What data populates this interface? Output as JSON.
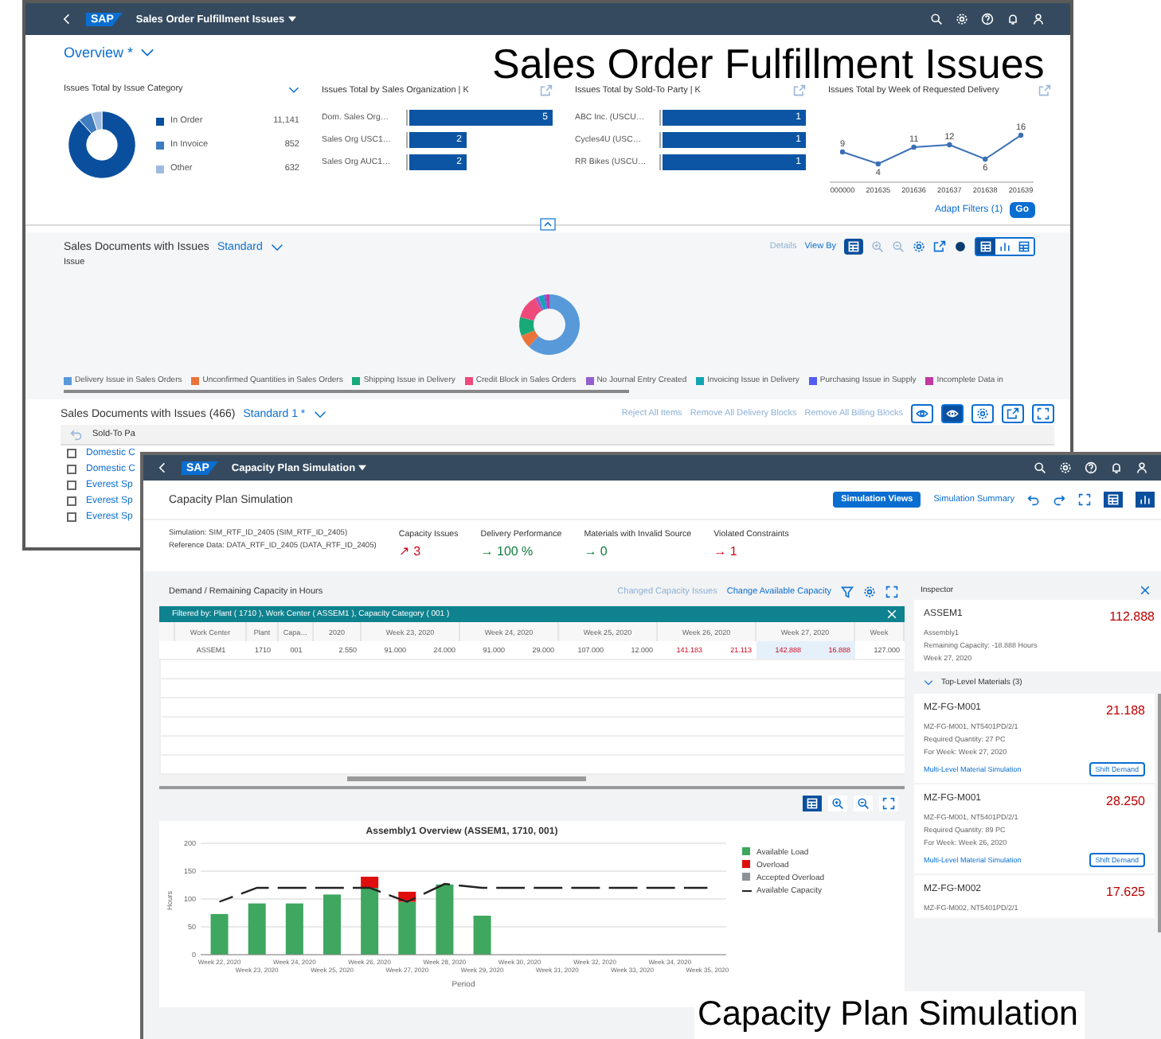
{
  "sales_window": {
    "shell": {
      "logo": "SAP",
      "title": "Sales Order Fulfillment Issues"
    },
    "variant": "Overview *",
    "cards": [
      {
        "title": "Issues Total by Issue Category",
        "kind": "donut",
        "legend": [
          {
            "label": "In Order",
            "value": "11,141",
            "color": "#0a4f9e"
          },
          {
            "label": "In Invoice",
            "value": "852",
            "color": "#3f7cc0"
          },
          {
            "label": "Other",
            "value": "632",
            "color": "#9dbbe0"
          }
        ]
      },
      {
        "title": "Issues Total by Sales Organization | K",
        "chart_data": {
          "type": "bar",
          "orientation": "horizontal",
          "categories": [
            "Dom. Sales Org…",
            "Sales Org USC1…",
            "Sales Org AUC1…"
          ],
          "values": [
            5,
            2,
            2
          ],
          "data_labels": true
        }
      },
      {
        "title": "Issues Total by Sold-To Party | K",
        "chart_data": {
          "type": "bar",
          "orientation": "horizontal",
          "categories": [
            "ABC Inc. (USCU…",
            "Cycles4U (USC…",
            "RR Bikes (USCU…"
          ],
          "values": [
            1,
            1,
            1
          ],
          "data_labels": true
        }
      },
      {
        "title": "Issues Total by Week of Requested Delivery",
        "chart_data": {
          "type": "line",
          "categories": [
            "000000",
            "201635",
            "201636",
            "201637",
            "201638",
            "201639"
          ],
          "values": [
            9,
            4,
            11,
            12,
            6,
            16
          ],
          "data_labels": true,
          "marker": true
        }
      }
    ],
    "adapt_filters": "Adapt Filters (1)",
    "go": "Go",
    "section": {
      "title": "Sales Documents with Issues",
      "variant": "Standard",
      "details": "Details",
      "view_by": "View By",
      "view_switch": [
        {
          "selected": true
        },
        {
          "selected": false
        },
        {
          "selected": false
        }
      ],
      "chart_label": "Issue",
      "legend": [
        {
          "label": "Delivery Issue in Sales Orders",
          "color": "#5899da"
        },
        {
          "label": "Unconfirmed Quantities in Sales Orders",
          "color": "#e8743b"
        },
        {
          "label": "Shipping Issue in Delivery",
          "color": "#19a979"
        },
        {
          "label": "Credit Block in Sales Orders",
          "color": "#ed4a7b"
        },
        {
          "label": "No Journal Entry Created",
          "color": "#945ecf"
        },
        {
          "label": "Invoicing Issue in Delivery",
          "color": "#13a4b4"
        },
        {
          "label": "Purchasing Issue in Supply",
          "color": "#525df4"
        },
        {
          "label": "Incomplete Data in",
          "color": "#bf399e"
        }
      ]
    },
    "table": {
      "title": "Sales Documents with Issues (466)",
      "variant": "Standard 1 *",
      "actions": [
        "Reject All Items",
        "Remove All Delivery Blocks",
        "Remove All Billing Blocks"
      ],
      "column": "Sold-To Pa",
      "rows": [
        {
          "text": "Domestic C",
          "selected": false
        },
        {
          "text": "Domestic C",
          "selected": false
        },
        {
          "text": "Everest Sp",
          "selected": false
        },
        {
          "text": "Everest Sp",
          "selected": false
        },
        {
          "text": "Everest Sp",
          "selected": false
        }
      ]
    }
  },
  "capacity_window": {
    "shell": {
      "logo": "SAP",
      "title": "Capacity Plan Simulation"
    },
    "header": {
      "title": "Capacity Plan Simulation",
      "views_button": "Simulation Views",
      "summary_link": "Simulation Summary",
      "view_toggles": [
        {
          "selected": true
        },
        {
          "selected": true
        }
      ]
    },
    "info": [
      "Simulation: SIM_RTF_ID_2405 (SIM_RTF_ID_2405)",
      "Reference Data: DATA_RTF_ID_2405 (DATA_RTF_ID_2405)"
    ],
    "kpis": [
      {
        "label": "Capacity Issues",
        "arrow": "↗",
        "value": "3",
        "color": "#d0021b"
      },
      {
        "label": "Delivery Performance",
        "arrow": "→",
        "value": "100 %",
        "color": "#107e3e"
      },
      {
        "label": "Materials with Invalid Source",
        "arrow": "→",
        "value": "0",
        "color": "#107e3e"
      },
      {
        "label": "Violated Constraints",
        "arrow": "→",
        "value": "1",
        "color": "#d0021b"
      }
    ],
    "demand": {
      "title": "Demand / Remaining Capacity in Hours",
      "links": [
        {
          "text": "Changed Capacity Issues",
          "disabled": true
        },
        {
          "text": "Change Available Capacity",
          "disabled": false
        }
      ],
      "filter": "Filtered by: Plant ( 1710 ), Work Center ( ASSEM1 ), Capacity Category ( 001 )",
      "columns": [
        "Work Center",
        "Plant",
        "Capa…"
      ],
      "weeks": [
        {
          "label": "2020",
          "partial": true,
          "selected": false
        },
        {
          "label": "Week 23, 2020",
          "partial": false,
          "selected": false
        },
        {
          "label": "Week 24, 2020",
          "partial": false,
          "selected": false
        },
        {
          "label": "Week 25, 2020",
          "partial": false,
          "selected": false
        },
        {
          "label": "Week 26, 2020",
          "partial": false,
          "selected": false
        },
        {
          "label": "Week 27, 2020",
          "partial": false,
          "selected": true
        },
        {
          "label": "Week",
          "partial": true,
          "selected": false
        }
      ],
      "row": {
        "work_center": "ASSEM1",
        "plant": "1710",
        "category": "001",
        "cells": [
          {
            "text": "2.550",
            "over": false
          },
          {
            "text": "91.000",
            "over": false
          },
          {
            "text": "24.000",
            "over": false
          },
          {
            "text": "91.000",
            "over": false
          },
          {
            "text": "29.000",
            "over": false
          },
          {
            "text": "107.000",
            "over": false
          },
          {
            "text": "12.000",
            "over": false
          },
          {
            "text": "141.183",
            "over": true
          },
          {
            "text": "21.113",
            "over": true
          },
          {
            "text": "142.888",
            "over": true
          },
          {
            "text": "16.888",
            "over": true
          },
          {
            "text": "127.000",
            "over": false
          }
        ]
      },
      "chart_tools": [
        {
          "selected": true
        },
        {
          "selected": false
        },
        {
          "selected": false
        },
        {
          "selected": false
        }
      ],
      "chart_data": {
        "type": "bar",
        "title": "Assembly1 Overview (ASSEM1, 1710, 001)",
        "xlabel": "Period",
        "ylabel": "Hours",
        "stacked": true,
        "grid": true,
        "legend": "right",
        "ylim": [
          0,
          200
        ],
        "yticks": [
          0,
          50,
          100,
          150,
          200
        ],
        "categories": [
          "Week 22, 2020",
          "Week 23, 2020",
          "Week 24, 2020",
          "Week 25, 2020",
          "Week 26, 2020",
          "Week 27, 2020",
          "Week 28, 2020",
          "Week 29, 2020",
          "Week 30, 2020",
          "Week 31, 2020",
          "Week 32, 2020",
          "Week 33, 2020",
          "Week 34, 2020",
          "Week 35, 2020"
        ],
        "series": [
          {
            "name": "Available Load",
            "color": "#3fa75f",
            "values": [
              73,
              92,
              92,
              108,
              120,
              95,
              126,
              70,
              null,
              null,
              null,
              null,
              null,
              null
            ]
          },
          {
            "name": "Overload",
            "color": "#e00d0d",
            "values": [
              null,
              null,
              null,
              null,
              20,
              18,
              null,
              null,
              null,
              null,
              null,
              null,
              null,
              null
            ]
          },
          {
            "name": "Accepted Overload",
            "color": "#8c9296",
            "values": [
              null,
              null,
              null,
              null,
              null,
              null,
              null,
              null,
              null,
              null,
              null,
              null,
              null,
              null
            ]
          },
          {
            "name": "Available Capacity",
            "color": "#222222",
            "type": "line",
            "line_style": "dashed",
            "values": [
              95,
              120,
              120,
              120,
              120,
              95,
              127,
              120,
              120,
              120,
              120,
              120,
              120,
              120
            ]
          }
        ]
      }
    },
    "inspector": {
      "title": "Inspector",
      "card": {
        "name": "ASSEM1",
        "value": "112.888",
        "lines": [
          "Assembly1",
          "Remaining Capacity: -18.888 Hours",
          "Week 27, 2020"
        ]
      },
      "section": {
        "title": "Top-Level Materials (3)",
        "expanded": true
      },
      "items": [
        {
          "name": "MZ-FG-M001",
          "value": "21.188",
          "lines": [
            "MZ-FG-M001, NT5401PD/2/1",
            "Required Quantity: 27 PC",
            "For Week: Week 27, 2020"
          ],
          "link": "Multi-Level Material Simulation",
          "button": "Shift Demand"
        },
        {
          "name": "MZ-FG-M001",
          "value": "28.250",
          "lines": [
            "MZ-FG-M001, NT5401PD/2/1",
            "Required Quantity: 89 PC",
            "For Week: Week 26, 2020"
          ],
          "link": "Multi-Level Material Simulation",
          "button": "Shift Demand"
        },
        {
          "name": "MZ-FG-M002",
          "value": "17.625",
          "lines": [
            "MZ-FG-M002, NT5401PD/2/1"
          ]
        }
      ]
    }
  },
  "captions": [
    "Sales Order Fulfillment Issues",
    "Capacity Plan Simulation"
  ]
}
